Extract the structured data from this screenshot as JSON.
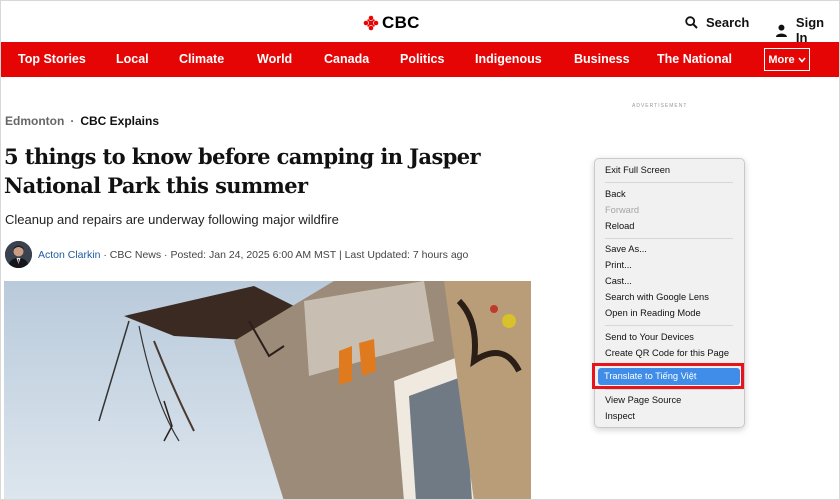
{
  "brand": {
    "logo_text": "CBC",
    "accent": "#e60505"
  },
  "header": {
    "search_label": "Search",
    "signin_label": "Sign In"
  },
  "nav": {
    "items": [
      "Top Stories",
      "Local",
      "Climate",
      "World",
      "Canada",
      "Politics",
      "Indigenous",
      "Business",
      "The National"
    ],
    "more_label": "More"
  },
  "article": {
    "breadcrumb": [
      "Edmonton",
      "CBC Explains"
    ],
    "headline": "5 things to know before camping in Jasper National Park this summer",
    "deck": "Cleanup and repairs are underway following major wildfire",
    "author": "Acton Clarkin",
    "byline_rest": " · CBC News · Posted: Jan 24, 2025 6:00 AM MST | Last Updated: 7 hours ago"
  },
  "ad_label": "ADVERTISEMENT",
  "context_menu": {
    "items": [
      {
        "label": "Exit Full Screen",
        "enabled": true
      },
      {
        "label": "Back",
        "enabled": true
      },
      {
        "label": "Forward",
        "enabled": false
      },
      {
        "label": "Reload",
        "enabled": true
      },
      {
        "label": "Save As...",
        "enabled": true
      },
      {
        "label": "Print...",
        "enabled": true
      },
      {
        "label": "Cast...",
        "enabled": true
      },
      {
        "label": "Search with Google Lens",
        "enabled": true
      },
      {
        "label": "Open in Reading Mode",
        "enabled": true
      },
      {
        "label": "Send to Your Devices",
        "enabled": true
      },
      {
        "label": "Create QR Code for this Page",
        "enabled": true
      },
      {
        "label": "Translate to Tiếng Việt",
        "enabled": true,
        "highlighted": true
      },
      {
        "label": "View Page Source",
        "enabled": true
      },
      {
        "label": "Inspect",
        "enabled": true
      }
    ],
    "highlight_color": "#3f8de8",
    "callout_color": "#e8141b"
  }
}
